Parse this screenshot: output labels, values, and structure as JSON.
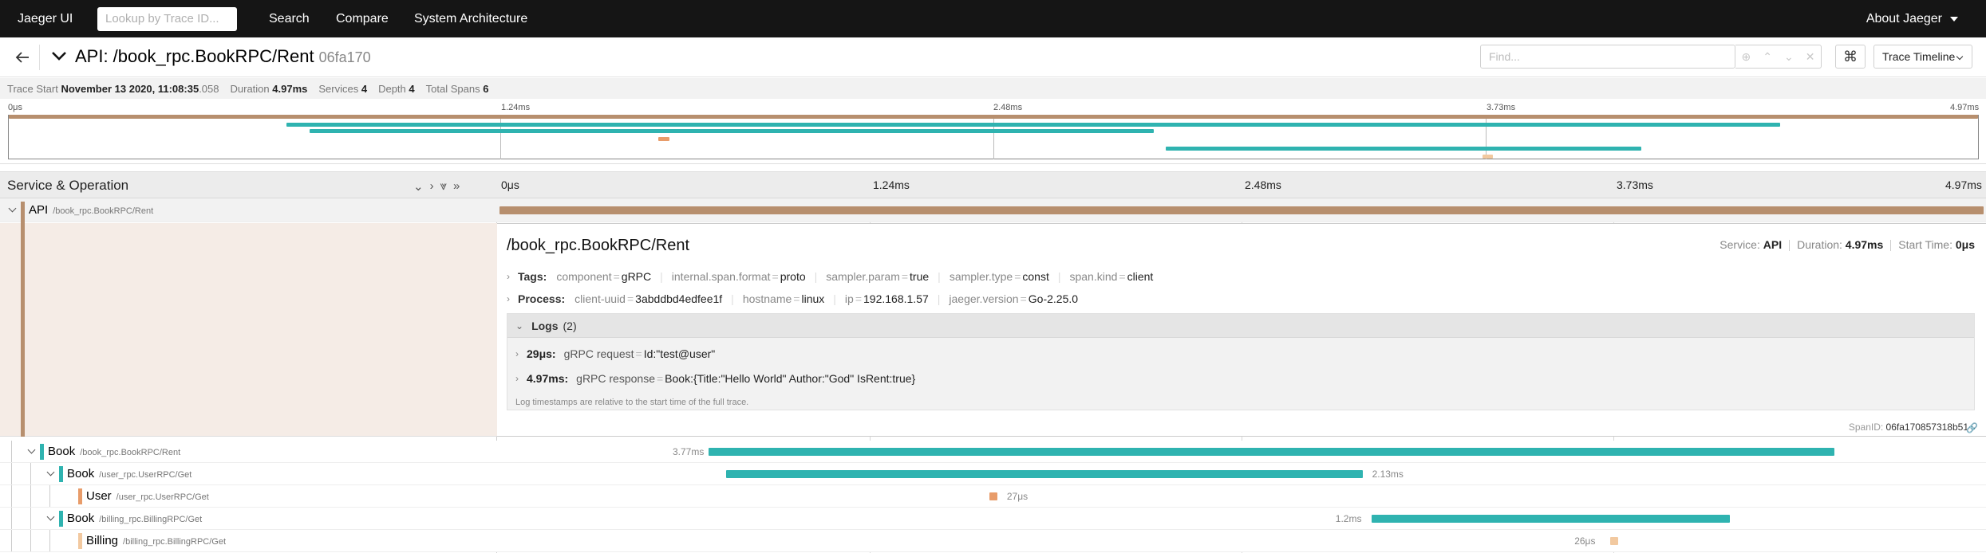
{
  "nav": {
    "brand": "Jaeger UI",
    "lookup_placeholder": "Lookup by Trace ID...",
    "links": [
      "Search",
      "Compare",
      "System Architecture"
    ],
    "about": "About Jaeger"
  },
  "trace": {
    "title": "API: /book_rpc.BookRPC/Rent",
    "trace_id": "06fa170",
    "find_placeholder": "Find...",
    "view_mode": "Trace Timeline"
  },
  "summary": {
    "trace_start_label": "Trace Start",
    "trace_start_date": "November 13 2020, 11:08:35",
    "trace_start_ms": ".058",
    "duration_label": "Duration",
    "duration": "4.97ms",
    "services_label": "Services",
    "services": "4",
    "depth_label": "Depth",
    "depth": "4",
    "total_spans_label": "Total Spans",
    "total_spans": "6"
  },
  "ticks": [
    "0μs",
    "1.24ms",
    "2.48ms",
    "3.73ms",
    "4.97ms"
  ],
  "timeline_header": {
    "title": "Service & Operation"
  },
  "colors": {
    "api": "#b78f6e",
    "book": "#2fb3b0",
    "user": "#e89c6a",
    "billing": "#f2c9a0"
  },
  "spans": [
    {
      "service": "API",
      "operation": "/book_rpc.BookRPC/Rent",
      "depth": 0,
      "start_ms": 0,
      "duration_ms": 4.97,
      "label": "",
      "color": "#b78f6e"
    },
    {
      "service": "Book",
      "operation": "/book_rpc.BookRPC/Rent",
      "depth": 1,
      "start_ms": 0.7,
      "duration_ms": 3.77,
      "label": "3.77ms",
      "color": "#2fb3b0"
    },
    {
      "service": "Book",
      "operation": "/user_rpc.UserRPC/Get",
      "depth": 2,
      "start_ms": 0.76,
      "duration_ms": 2.13,
      "label": "2.13ms",
      "color": "#2fb3b0"
    },
    {
      "service": "User",
      "operation": "/user_rpc.UserRPC/Get",
      "depth": 3,
      "start_ms": 1.64,
      "duration_ms": 0.027,
      "label": "27μs",
      "color": "#e89c6a"
    },
    {
      "service": "Book",
      "operation": "/billing_rpc.BillingRPC/Get",
      "depth": 2,
      "start_ms": 2.92,
      "duration_ms": 1.2,
      "label": "1.2ms",
      "color": "#2fb3b0"
    },
    {
      "service": "Billing",
      "operation": "/billing_rpc.BillingRPC/Get",
      "depth": 3,
      "start_ms": 3.72,
      "duration_ms": 0.026,
      "label": "26μs",
      "color": "#f2c9a0"
    }
  ],
  "detail": {
    "operation": "/book_rpc.BookRPC/Rent",
    "service_label": "Service:",
    "service": "API",
    "duration_label": "Duration:",
    "duration": "4.97ms",
    "start_label": "Start Time:",
    "start": "0μs",
    "tags_label": "Tags:",
    "tags": [
      {
        "k": "component",
        "v": "gRPC"
      },
      {
        "k": "internal.span.format",
        "v": "proto"
      },
      {
        "k": "sampler.param",
        "v": "true"
      },
      {
        "k": "sampler.type",
        "v": "const"
      },
      {
        "k": "span.kind",
        "v": "client"
      }
    ],
    "process_label": "Process:",
    "process": [
      {
        "k": "client-uuid",
        "v": "3abddbd4edfee1f"
      },
      {
        "k": "hostname",
        "v": "linux"
      },
      {
        "k": "ip",
        "v": "192.168.1.57"
      },
      {
        "k": "jaeger.version",
        "v": "Go-2.25.0"
      }
    ],
    "logs_label": "Logs",
    "logs_count": "(2)",
    "logs": [
      {
        "time": "29μs:",
        "k": "gRPC request",
        "v": "Id:\"test@user\""
      },
      {
        "time": "4.97ms:",
        "k": "gRPC response",
        "v": "Book:{Title:\"Hello World\" Author:\"God\" IsRent:true}"
      }
    ],
    "logs_note": "Log timestamps are relative to the start time of the full trace.",
    "span_id_label": "SpanID:",
    "span_id": "06fa170857318b51"
  }
}
